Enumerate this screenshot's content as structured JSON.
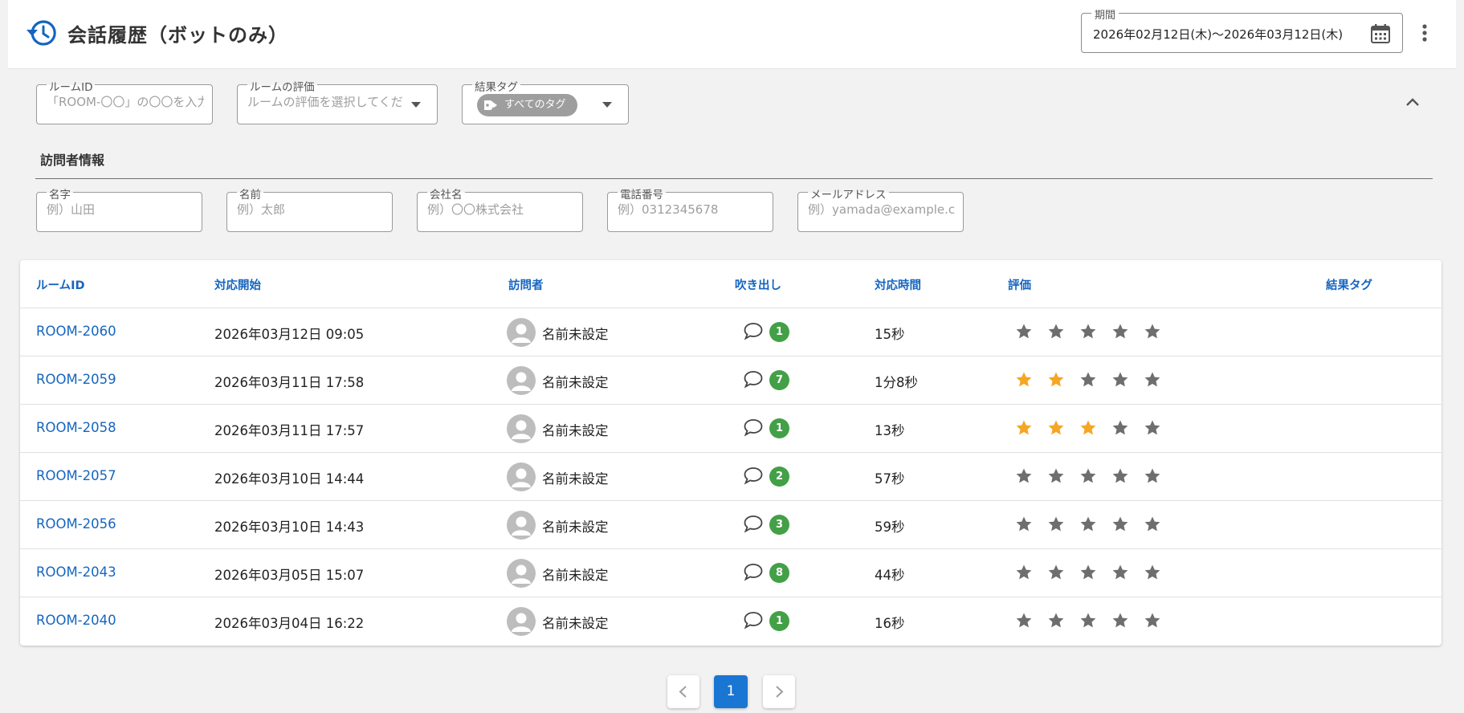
{
  "header": {
    "title": "会話履歴（ボットのみ）",
    "period_label": "期間",
    "period_value": "2026年02月12日(木)〜2026年03月12日(木)"
  },
  "filters": {
    "room_id": {
      "label": "ルームID",
      "placeholder": "「ROOM-〇〇」の〇〇を入力"
    },
    "rating": {
      "label": "ルームの評価",
      "placeholder": "ルームの評価を選択してください"
    },
    "result_tag": {
      "label": "結果タグ",
      "chip": "すべてのタグ"
    },
    "visitor_section_title": "訪問者情報",
    "last_name": {
      "label": "名字",
      "placeholder": "例）山田"
    },
    "first_name": {
      "label": "名前",
      "placeholder": "例）太郎"
    },
    "company": {
      "label": "会社名",
      "placeholder": "例）〇〇株式会社"
    },
    "phone": {
      "label": "電話番号",
      "placeholder": "例）0312345678"
    },
    "email": {
      "label": "メールアドレス",
      "placeholder": "例）yamada@example.com"
    }
  },
  "table": {
    "columns": {
      "room_id": "ルームID",
      "start": "対応開始",
      "visitor": "訪問者",
      "bubbles": "吹き出し",
      "duration": "対応時間",
      "rating": "評価",
      "result_tag": "結果タグ"
    },
    "rows": [
      {
        "room_id": "ROOM-2060",
        "start": "2026年03月12日 09:05",
        "visitor": "名前未設定",
        "bubbles": "1",
        "duration": "15秒",
        "rating": 0,
        "result_tag": ""
      },
      {
        "room_id": "ROOM-2059",
        "start": "2026年03月11日 17:58",
        "visitor": "名前未設定",
        "bubbles": "7",
        "duration": "1分8秒",
        "rating": 2,
        "result_tag": ""
      },
      {
        "room_id": "ROOM-2058",
        "start": "2026年03月11日 17:57",
        "visitor": "名前未設定",
        "bubbles": "1",
        "duration": "13秒",
        "rating": 3,
        "result_tag": ""
      },
      {
        "room_id": "ROOM-2057",
        "start": "2026年03月10日 14:44",
        "visitor": "名前未設定",
        "bubbles": "2",
        "duration": "57秒",
        "rating": 0,
        "result_tag": ""
      },
      {
        "room_id": "ROOM-2056",
        "start": "2026年03月10日 14:43",
        "visitor": "名前未設定",
        "bubbles": "3",
        "duration": "59秒",
        "rating": 0,
        "result_tag": ""
      },
      {
        "room_id": "ROOM-2043",
        "start": "2026年03月05日 15:07",
        "visitor": "名前未設定",
        "bubbles": "8",
        "duration": "44秒",
        "rating": 0,
        "result_tag": ""
      },
      {
        "room_id": "ROOM-2040",
        "start": "2026年03月04日 16:22",
        "visitor": "名前未設定",
        "bubbles": "1",
        "duration": "16秒",
        "rating": 0,
        "result_tag": ""
      }
    ]
  },
  "pagination": {
    "current_page": "1"
  },
  "colors": {
    "accent_blue": "#1565c0",
    "page_button_blue": "#1976d2",
    "badge_green": "#43a047",
    "star_active": "#f5a623",
    "star_inactive": "#6e6e6e",
    "chip_grey": "#9e9e9e"
  },
  "icons": {
    "header": "history-icon",
    "period": "calendar-icon",
    "menu": "more-vert-icon",
    "collapse": "chevron-up-icon",
    "tag_chip": "tag-icon",
    "visitor": "person-avatar-icon",
    "bubbles": "chat-bubble-icon",
    "rating": "star-icon",
    "prev": "chevron-left-icon",
    "next": "chevron-right-icon"
  }
}
